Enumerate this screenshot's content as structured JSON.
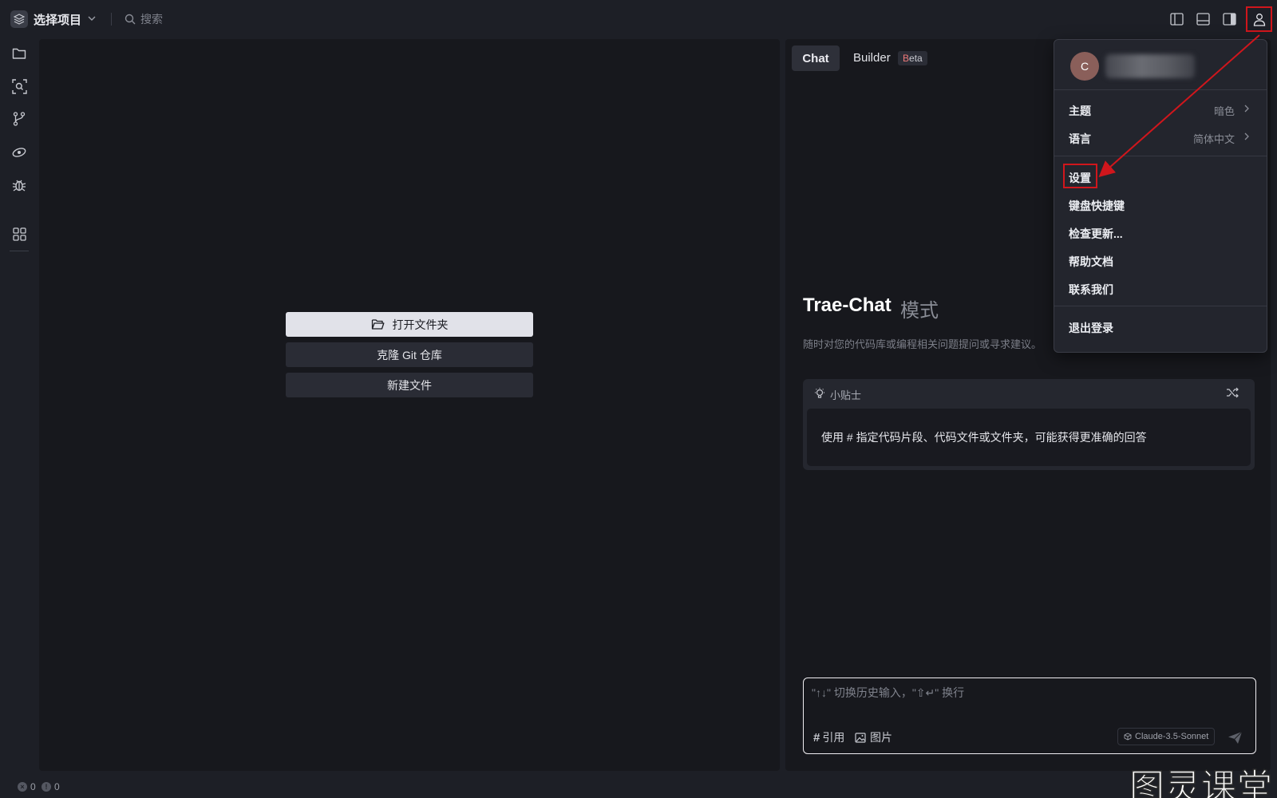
{
  "topbar": {
    "project_label": "选择项目",
    "search_placeholder": "搜索"
  },
  "activity_bar": {
    "icons": [
      "folder-icon",
      "search-scan-icon",
      "source-control-icon",
      "live-preview-icon",
      "debug-icon",
      "extensions-icon"
    ]
  },
  "editor": {
    "open_folder_label": "打开文件夹",
    "clone_repo_label": "克隆 Git 仓库",
    "new_file_label": "新建文件"
  },
  "chat": {
    "tab_chat": "Chat",
    "tab_builder": "Builder",
    "beta_badge": "Beta",
    "title": "Trae-Chat",
    "title_mode": "模式",
    "subtitle": "随时对您的代码库或编程相关问题提问或寻求建议。",
    "tip_label": "小贴士",
    "tip_body": "使用 # 指定代码片段、代码文件或文件夹，可能获得更准确的回答",
    "input_placeholder": "\"↑↓\" 切换历史输入，\"⇧↵\" 换行",
    "ref_label": "引用",
    "image_label": "图片",
    "model_label": "Claude-3.5-Sonnet"
  },
  "user_menu": {
    "avatar_initial": "C",
    "items": {
      "theme_label": "主题",
      "theme_value": "暗色",
      "language_label": "语言",
      "language_value": "简体中文",
      "settings_label": "设置",
      "shortcuts_label": "键盘快捷键",
      "check_updates_label": "检查更新...",
      "help_docs_label": "帮助文档",
      "contact_label": "联系我们",
      "logout_label": "退出登录"
    }
  },
  "status_bar": {
    "errors": "0",
    "warnings": "0"
  },
  "watermark": "图灵课堂",
  "colors": {
    "background": "#1d1f26",
    "panel": "#17181d",
    "menu": "#23252d",
    "annotation_red": "#d0161c",
    "primary_button": "#e1e2e9"
  }
}
